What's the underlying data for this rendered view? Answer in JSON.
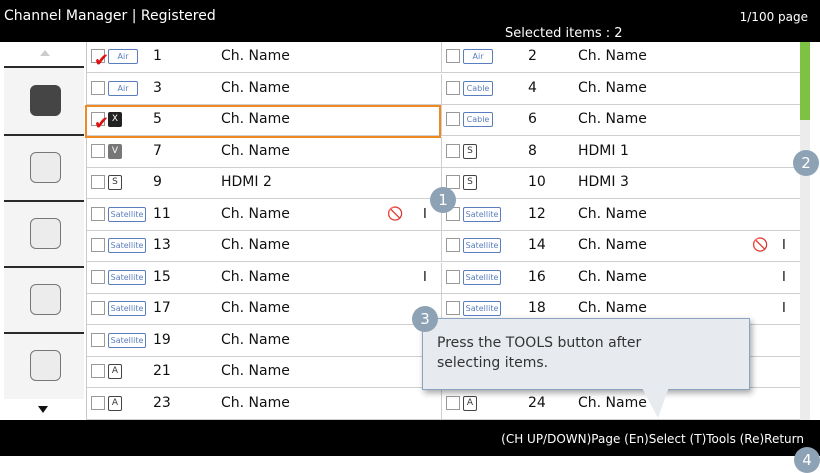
{
  "header": {
    "title": "Channel Manager | Registered",
    "page": "1/100 page",
    "selected": "Selected items : 2"
  },
  "left_col": {
    "items": [
      {
        "name": "channel-list-item-1"
      },
      {
        "name": "channel-list-item-2"
      }
    ]
  },
  "rows_left": [
    {
      "checked": true,
      "badge": "Air",
      "num": "1",
      "name": "Ch. Name"
    },
    {
      "checked": false,
      "badge": "Air",
      "num": "3",
      "name": "Ch. Name"
    },
    {
      "checked": true,
      "badge": "X",
      "num": "5",
      "name": "Ch. Name"
    },
    {
      "checked": false,
      "badge": "V",
      "num": "7",
      "name": "Ch. Name"
    },
    {
      "checked": false,
      "badge": "S",
      "num": "9",
      "name": "HDMI 2"
    },
    {
      "checked": false,
      "badge": "Satellite",
      "num": "11",
      "name": "Ch. Name"
    },
    {
      "checked": false,
      "badge": "Satellite",
      "num": "13",
      "name": "Ch. Name"
    },
    {
      "checked": false,
      "badge": "Satellite",
      "num": "15",
      "name": "Ch. Name"
    },
    {
      "checked": false,
      "badge": "Satellite",
      "num": "17",
      "name": "Ch. Name"
    },
    {
      "checked": false,
      "badge": "Satellite",
      "num": "19",
      "name": "Ch. Name"
    },
    {
      "checked": false,
      "badge": "A",
      "num": "21",
      "name": "Ch. Name"
    },
    {
      "checked": false,
      "badge": "A",
      "num": "23",
      "name": "Ch. Name"
    }
  ],
  "rows_right": [
    {
      "checked": false,
      "badge": "Air",
      "num": "2",
      "name": "Ch. Name"
    },
    {
      "checked": false,
      "badge": "Cable",
      "num": "4",
      "name": "Ch. Name"
    },
    {
      "checked": false,
      "badge": "Cable",
      "num": "6",
      "name": "Ch. Name"
    },
    {
      "checked": false,
      "badge": "S",
      "num": "8",
      "name": "HDMI 1"
    },
    {
      "checked": false,
      "badge": "S",
      "num": "10",
      "name": "HDMI 3"
    },
    {
      "checked": false,
      "badge": "Satellite",
      "num": "12",
      "name": "Ch. Name"
    },
    {
      "checked": false,
      "badge": "Satellite",
      "num": "14",
      "name": "Ch. Name"
    },
    {
      "checked": false,
      "badge": "Satellite",
      "num": "16",
      "name": "Ch. Name"
    },
    {
      "checked": false,
      "badge": "Satellite",
      "num": "18",
      "name": "Ch. Name"
    },
    {
      "checked": false,
      "badge": "",
      "num": "",
      "name": ""
    },
    {
      "checked": false,
      "badge": "",
      "num": "",
      "name": ""
    },
    {
      "checked": false,
      "badge": "A",
      "num": "24",
      "name": "Ch. Name"
    }
  ],
  "tooltip": {
    "line1": "Press the TOOLS button after",
    "line2": "selecting items."
  },
  "bottom": {
    "keys": "(CH UP/DOWN)Page  (En)Select  (T)Tools  (Re)Return"
  },
  "markers": [
    "1",
    "2",
    "3",
    "4"
  ],
  "colors": {
    "focus": "#ef8a22",
    "scroll_thumb": "#7dc242",
    "check": "#dd1111"
  },
  "icons": {
    "lock": "lock-icon",
    "rec": "record-icon"
  }
}
